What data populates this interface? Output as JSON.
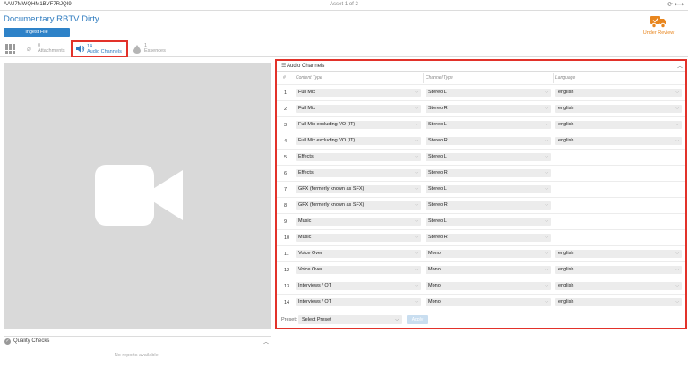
{
  "header": {
    "asset_id": "AAU7MWQHM1BVF7RJQI9",
    "asset_count": "Asset 1 of 2",
    "title": "Documentary RBTV Dirty",
    "ingest_label": "Ingest File",
    "review_label": "Under Review",
    "accent_color": "#2e7bbf",
    "review_color": "#e8861f"
  },
  "tabs": [
    {
      "count": "0",
      "label": "Attachments",
      "icon": "paperclip-icon"
    },
    {
      "count": "14",
      "label": "Audio Channels",
      "icon": "speaker-icon"
    },
    {
      "count": "1",
      "label": "Essences",
      "icon": "drop-icon"
    }
  ],
  "quality_checks": {
    "title": "Quality Checks",
    "empty_text": "No reports available."
  },
  "audio_panel": {
    "title": "Audio Channels",
    "columns": {
      "num": "#",
      "content": "Content Type",
      "channel": "Channel Type",
      "language": "Language"
    },
    "rows": [
      {
        "num": "1",
        "content": "Full Mix",
        "channel": "Stereo L",
        "language": "english"
      },
      {
        "num": "2",
        "content": "Full Mix",
        "channel": "Stereo R",
        "language": "english"
      },
      {
        "num": "3",
        "content": "Full Mix excluding VO (IT)",
        "channel": "Stereo L",
        "language": "english"
      },
      {
        "num": "4",
        "content": "Full Mix excluding VO (IT)",
        "channel": "Stereo R",
        "language": "english"
      },
      {
        "num": "5",
        "content": "Effects",
        "channel": "Stereo L",
        "language": ""
      },
      {
        "num": "6",
        "content": "Effects",
        "channel": "Stereo R",
        "language": ""
      },
      {
        "num": "7",
        "content": "GFX (formerly known as SFX)",
        "channel": "Stereo L",
        "language": ""
      },
      {
        "num": "8",
        "content": "GFX (formerly known as SFX)",
        "channel": "Stereo R",
        "language": ""
      },
      {
        "num": "9",
        "content": "Music",
        "channel": "Stereo L",
        "language": ""
      },
      {
        "num": "10",
        "content": "Music",
        "channel": "Stereo R",
        "language": ""
      },
      {
        "num": "11",
        "content": "Voice Over",
        "channel": "Mono",
        "language": "english"
      },
      {
        "num": "12",
        "content": "Voice Over",
        "channel": "Mono",
        "language": "english"
      },
      {
        "num": "13",
        "content": "Interviews / OT",
        "channel": "Mono",
        "language": "english"
      },
      {
        "num": "14",
        "content": "Interviews / OT",
        "channel": "Mono",
        "language": "english"
      }
    ],
    "preset_label": "Preset:",
    "preset_value": "Select Preset",
    "apply_label": "Apply"
  }
}
